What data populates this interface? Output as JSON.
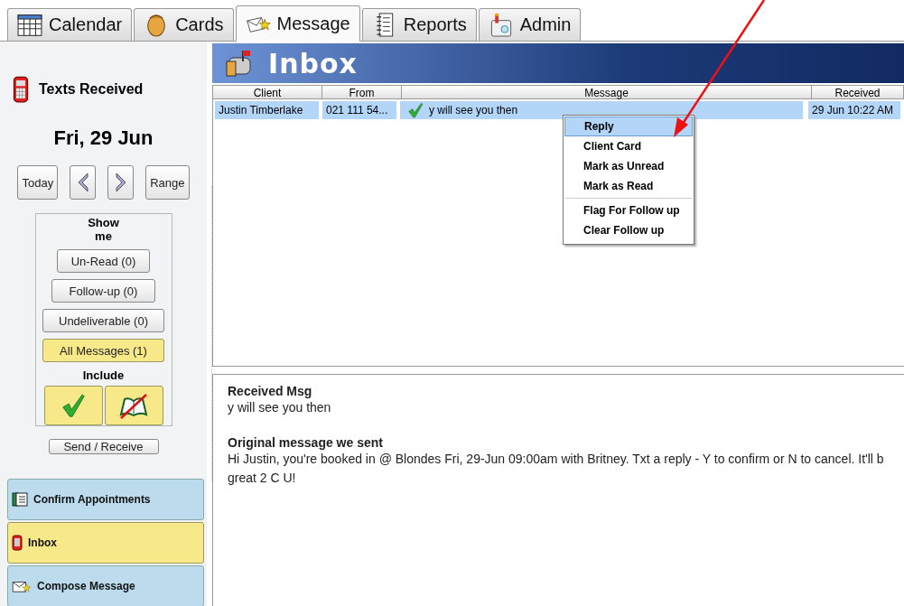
{
  "tabs": [
    {
      "label": "Calendar",
      "selected": false
    },
    {
      "label": "Cards",
      "selected": false
    },
    {
      "label": "Message",
      "selected": true
    },
    {
      "label": "Reports",
      "selected": false
    },
    {
      "label": "Admin",
      "selected": false
    }
  ],
  "sidebar": {
    "heading": "Texts Received",
    "date": "Fri, 29 Jun",
    "date_buttons": [
      {
        "kind": "text",
        "label": "Today"
      },
      {
        "kind": "prev"
      },
      {
        "kind": "next"
      },
      {
        "kind": "text",
        "label": "Range"
      }
    ],
    "show_me": {
      "title": "Show me",
      "filters": [
        {
          "label": "Un-Read (0)",
          "selected": false
        },
        {
          "label": "Follow-up (0)",
          "selected": false
        },
        {
          "label": "Undeliverable (0)",
          "selected": false
        },
        {
          "label": "All Messages (1)",
          "selected": true
        }
      ],
      "include_title": "Include",
      "include": [
        {
          "kind": "confirmed",
          "on": true
        },
        {
          "kind": "unbooked",
          "on": true
        }
      ]
    },
    "send_receive": "Send / Receive",
    "nav": [
      {
        "label": "Confirm Appointments",
        "selected": false
      },
      {
        "label": "Inbox",
        "selected": true
      },
      {
        "label": "Compose Message",
        "selected": false
      }
    ]
  },
  "inbox": {
    "title": "Inbox",
    "columns": [
      "Client",
      "From",
      "Message",
      "Received"
    ],
    "rows": [
      {
        "client": "Justin Timberlake",
        "from": "021 111 54...",
        "message": "y will see you then",
        "received": "29 Jun 10:22 AM",
        "confirmed": true,
        "selected": true
      }
    ]
  },
  "context_menu": {
    "groups": [
      [
        {
          "label": "Reply",
          "selected": true
        },
        {
          "label": "Client Card",
          "selected": false
        },
        {
          "label": "Mark as Unread",
          "selected": false
        },
        {
          "label": "Mark as Read",
          "selected": false
        }
      ],
      [
        {
          "label": "Flag For Follow up",
          "selected": false
        },
        {
          "label": "Clear Follow up",
          "selected": false
        }
      ]
    ]
  },
  "detail": [
    {
      "heading": "Received Msg",
      "body": "y will see you then"
    },
    {
      "heading": "Original message we sent",
      "body": "Hi Justin, you're booked in @ Blondes Fri, 29-Jun 09:00am with Britney. Txt a reply - Y to confirm or N to cancel. It'll b great 2 C U!"
    }
  ]
}
